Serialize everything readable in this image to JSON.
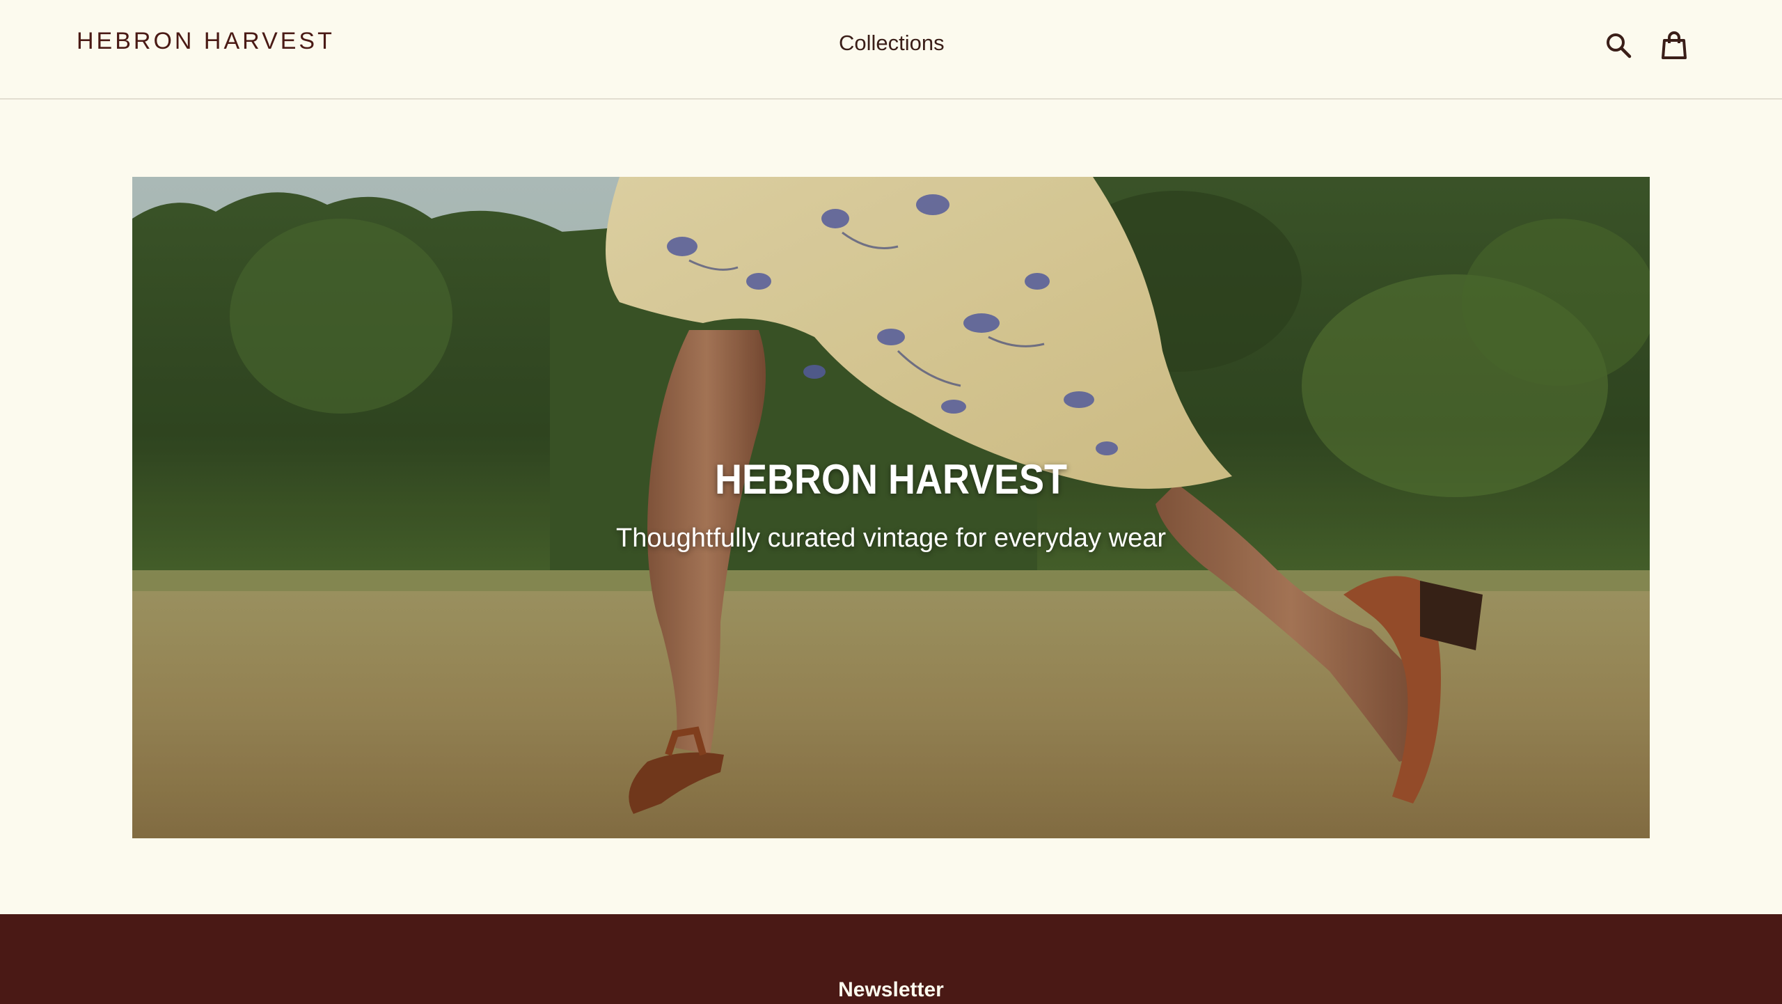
{
  "header": {
    "logo_text": "HEBRON HARVEST",
    "nav": [
      {
        "label": "Collections"
      }
    ],
    "icons": {
      "search": "search-icon",
      "cart": "cart-icon"
    }
  },
  "hero": {
    "title": "HEBRON HARVEST",
    "subtitle": "Thoughtfully curated vintage for everyday wear"
  },
  "footer": {
    "heading": "Newsletter"
  },
  "colors": {
    "background": "#fcfaee",
    "brand": "#4a1915",
    "text": "#3a1e18"
  }
}
